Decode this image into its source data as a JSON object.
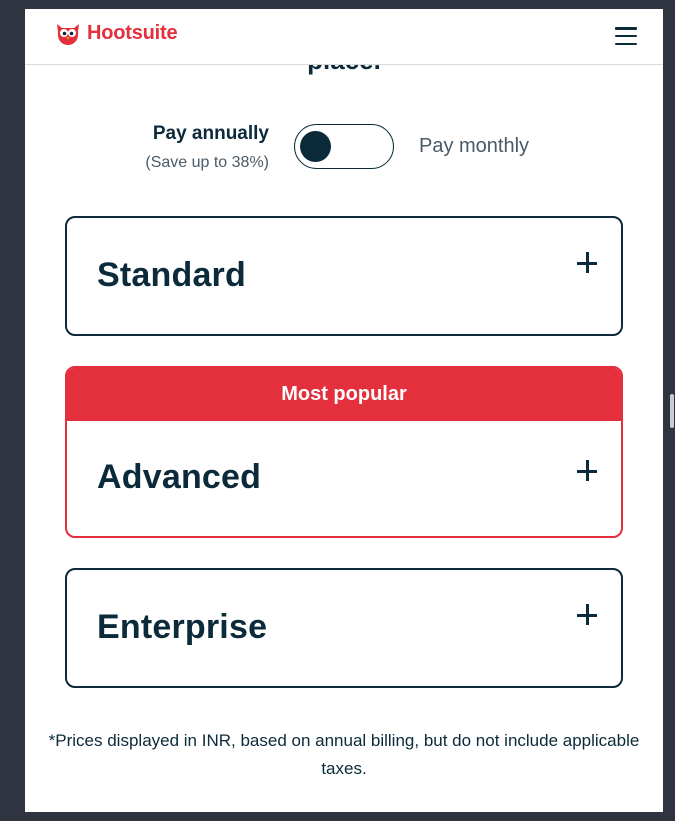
{
  "header": {
    "logo_text": "Hootsuite",
    "brand_color": "#e3303c",
    "menu_icon": "hamburger-menu-icon"
  },
  "section": {
    "cut_heading": "place."
  },
  "billing": {
    "annual_label": "Pay annually",
    "annual_save": "(Save up to 38%)",
    "monthly_label": "Pay monthly",
    "toggle_state": "annually"
  },
  "plans": [
    {
      "name": "Standard",
      "expand_icon": "plus-icon"
    },
    {
      "name": "Advanced",
      "badge": "Most popular",
      "expand_icon": "plus-icon",
      "accent": "#e3303c"
    },
    {
      "name": "Enterprise",
      "expand_icon": "plus-icon"
    }
  ],
  "footnote": "*Prices displayed in INR, based on annual billing, but do not include applicable taxes.",
  "colors": {
    "text_dark": "#0b2a3a",
    "popular_red": "#e3303c",
    "background": "#2f3440"
  }
}
